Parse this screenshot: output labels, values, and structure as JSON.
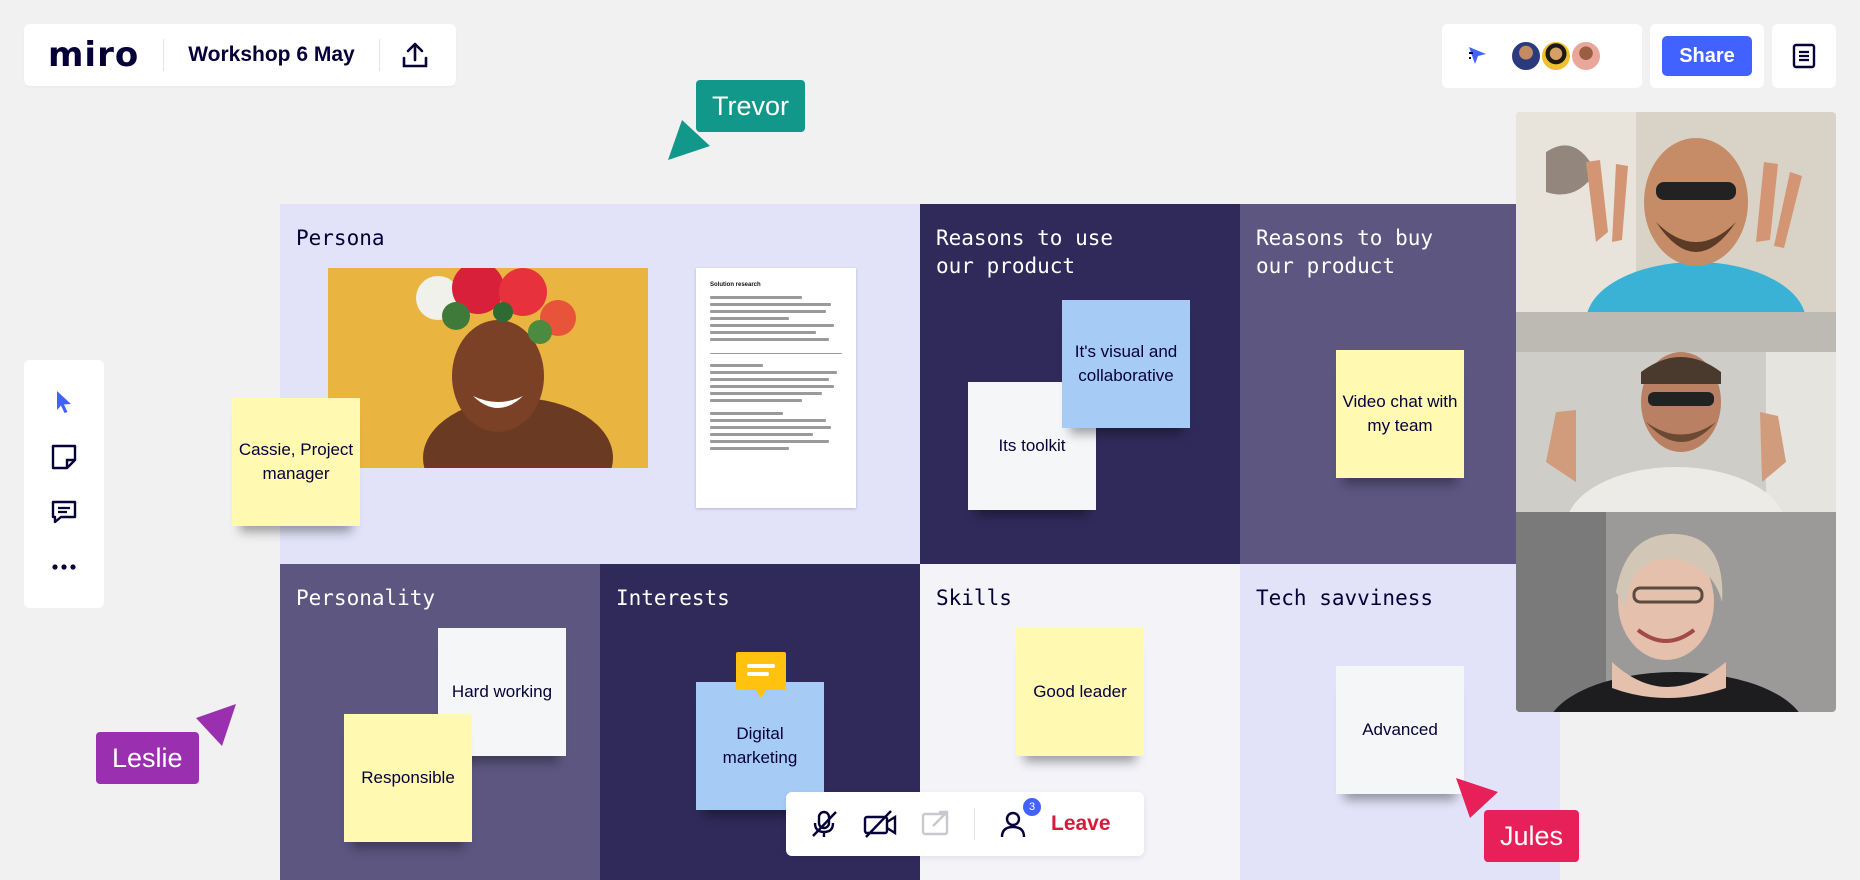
{
  "header": {
    "logo": "miro",
    "board_title": "Workshop 6 May",
    "share_label": "Share"
  },
  "board": {
    "cells": {
      "persona": "Persona",
      "reasons_use": "Reasons to use\nour product",
      "reasons_buy": "Reasons to buy\nour product",
      "personality": "Personality",
      "interests": "Interests",
      "skills": "Skills",
      "tech": "Tech savviness"
    },
    "stickies": {
      "cassie": "Cassie, Project manager",
      "visual": "It's visual and collaborative",
      "toolkit": "Its toolkit",
      "video_chat": "Video chat with my team",
      "hard_working": "Hard working",
      "responsible": "Responsible",
      "digital": "Digital marketing",
      "good_leader": "Good leader",
      "advanced": "Advanced"
    },
    "doc": {
      "heading": "Solution research"
    }
  },
  "cursors": {
    "trevor": "Trevor",
    "leslie": "Leslie",
    "jules": "Jules"
  },
  "callbar": {
    "participants_count": "3",
    "leave_label": "Leave"
  },
  "colors": {
    "accent": "#4262ff",
    "trevor": "#12988a",
    "leslie": "#9a2fb0",
    "jules": "#e8205a",
    "leave": "#d21e3c"
  }
}
